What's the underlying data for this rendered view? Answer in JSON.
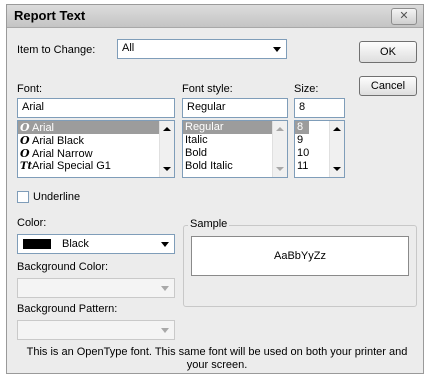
{
  "dialog": {
    "title": "Report Text",
    "close_label": "✕"
  },
  "item_to_change": {
    "label": "Item to Change:",
    "value": "All"
  },
  "buttons": {
    "ok": "OK",
    "cancel": "Cancel"
  },
  "font": {
    "label": "Font:",
    "value": "Arial",
    "items": [
      {
        "glyph": "O",
        "name": "Arial",
        "selected": true
      },
      {
        "glyph": "O",
        "name": "Arial Black",
        "selected": false
      },
      {
        "glyph": "O",
        "name": "Arial Narrow",
        "selected": false
      },
      {
        "glyph": "Tt",
        "name": "Arial Special G1",
        "selected": false
      }
    ]
  },
  "font_style": {
    "label": "Font style:",
    "value": "Regular",
    "items": [
      "Regular",
      "Italic",
      "Bold",
      "Bold Italic"
    ],
    "selected_index": 0
  },
  "size": {
    "label": "Size:",
    "value": "8",
    "items": [
      "8",
      "9",
      "10",
      "11"
    ],
    "selected_index": 0
  },
  "underline": {
    "label": "Underline",
    "checked": false
  },
  "color": {
    "label": "Color:",
    "value": "Black",
    "swatch": "#000000"
  },
  "background_color": {
    "label": "Background Color:",
    "value": ""
  },
  "background_pattern": {
    "label": "Background Pattern:",
    "value": ""
  },
  "sample": {
    "label": "Sample",
    "text": "AaBbYyZz"
  },
  "note": {
    "line1": "This is an OpenType font. This same font will be used on both your printer and",
    "line2": "your screen."
  },
  "colors": {
    "selection": "#9c9c9c",
    "field_border": "#7f9db9"
  },
  "icons": {
    "close": "close-icon",
    "combo_arrow": "chevron-down-icon"
  }
}
